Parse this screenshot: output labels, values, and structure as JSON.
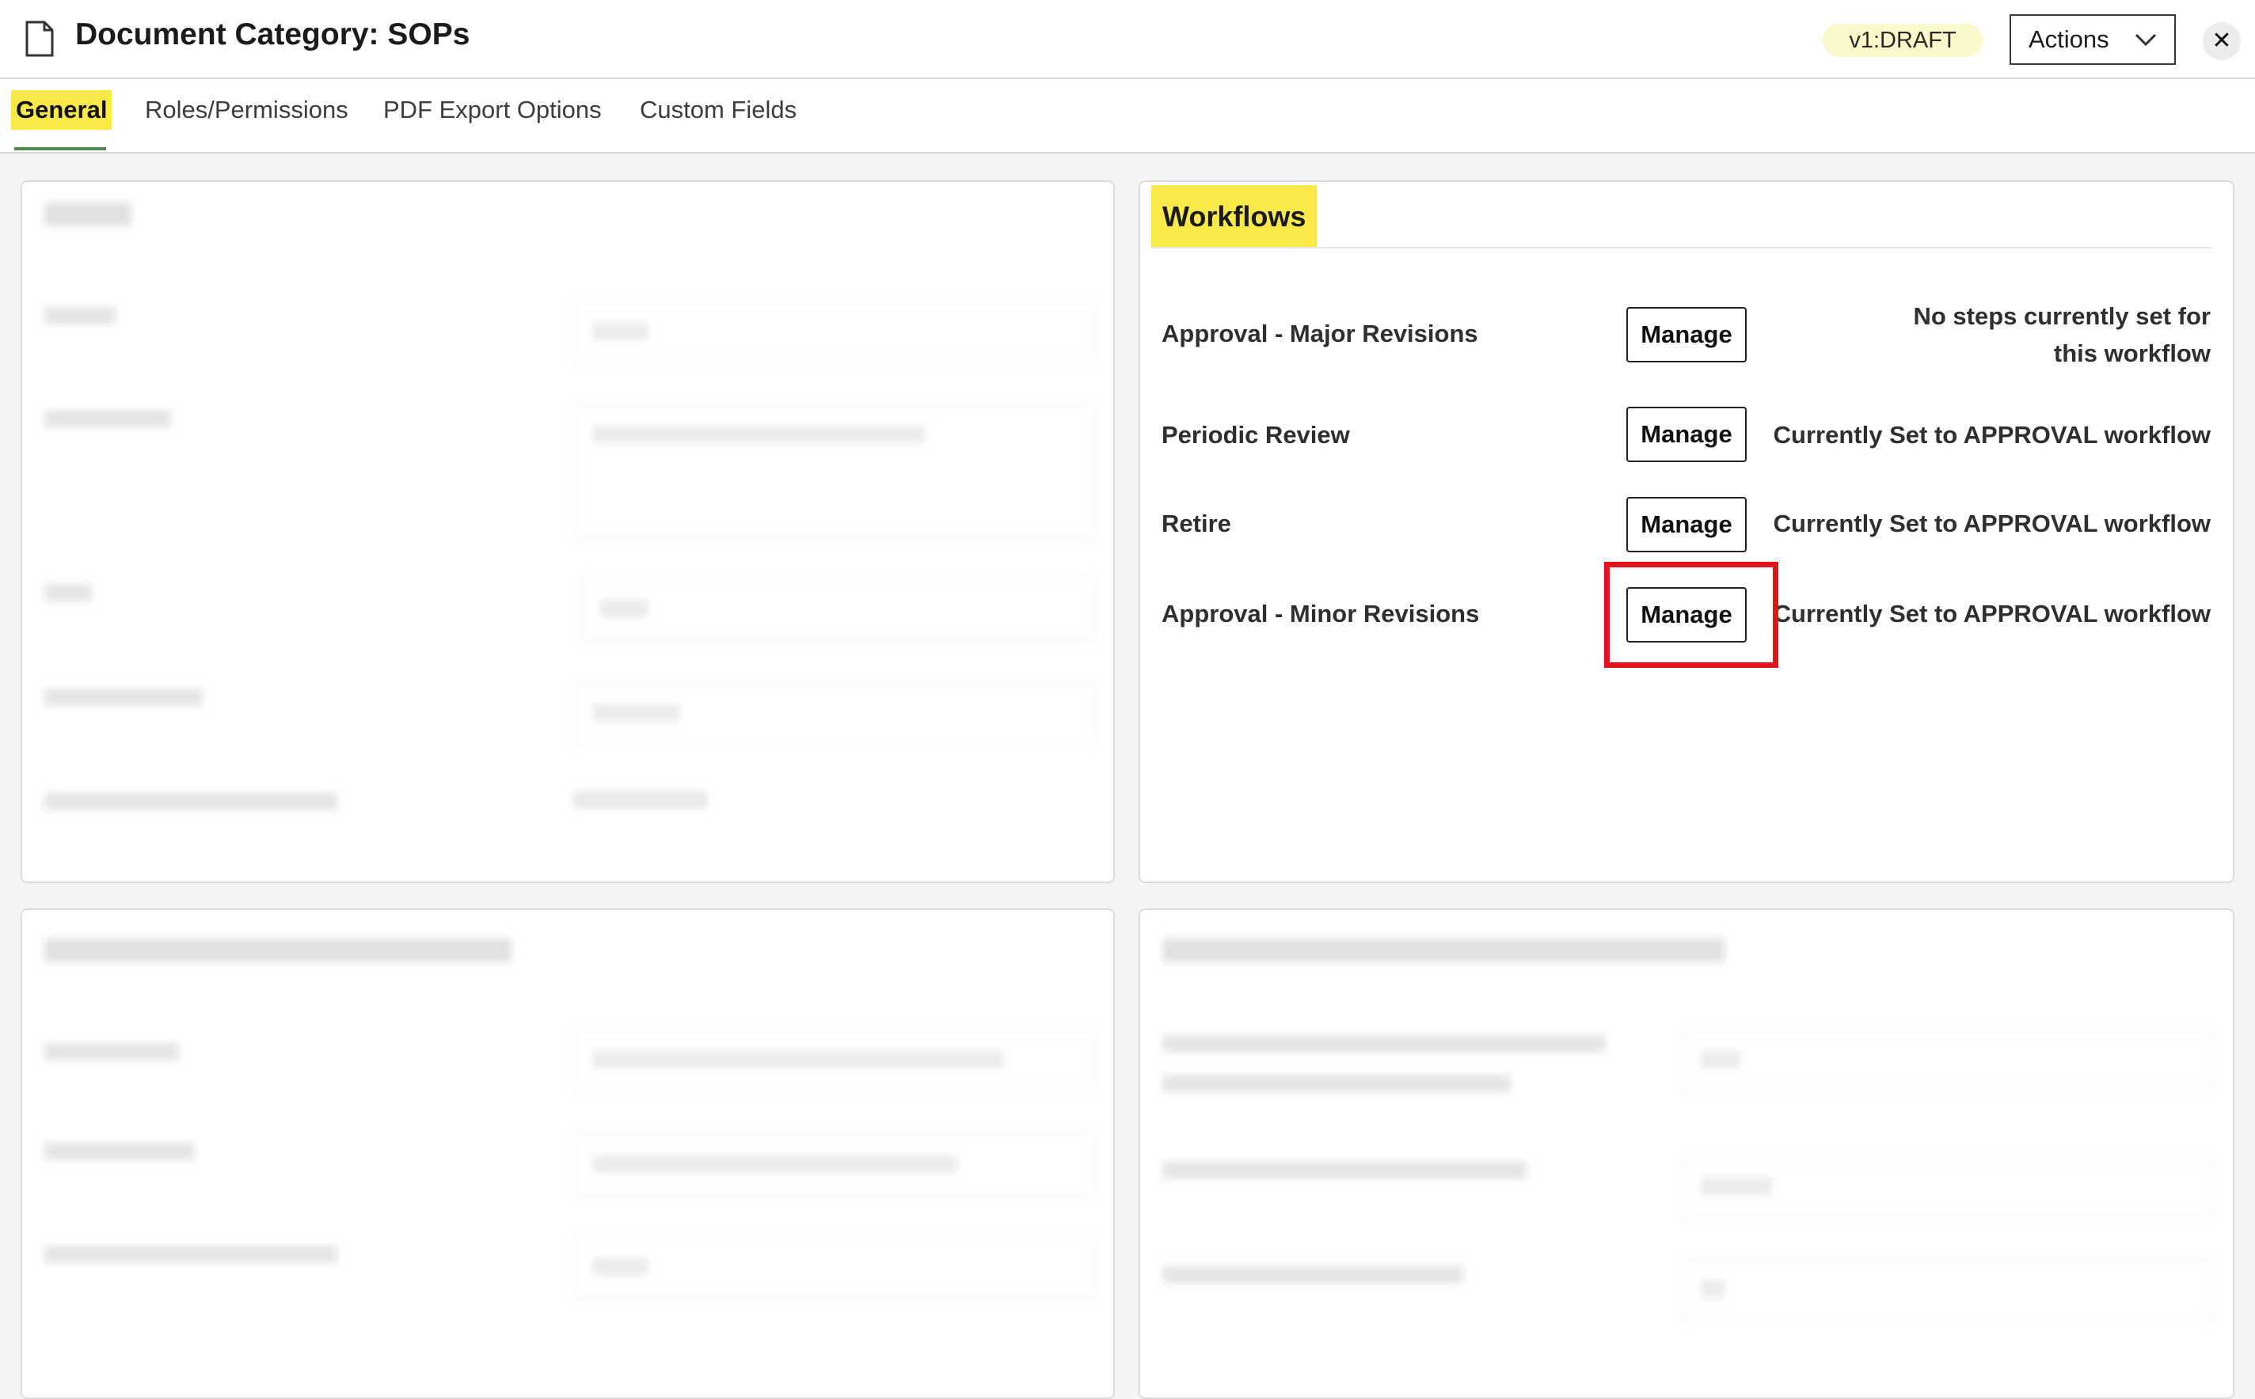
{
  "header": {
    "title": "Document Category: SOPs",
    "version_badge": "v1:DRAFT",
    "actions_label": "Actions",
    "close_label": "✕"
  },
  "tabs": [
    {
      "label": "General",
      "active": true
    },
    {
      "label": "Roles/Permissions",
      "active": false
    },
    {
      "label": "PDF Export Options",
      "active": false
    },
    {
      "label": "Custom Fields",
      "active": false
    }
  ],
  "workflows": {
    "heading": "Workflows",
    "items": [
      {
        "name": "Approval - Major Revisions",
        "button": "Manage",
        "status": "No steps currently set for this workflow"
      },
      {
        "name": "Periodic Review",
        "button": "Manage",
        "status": "Currently Set to APPROVAL workflow"
      },
      {
        "name": "Retire",
        "button": "Manage",
        "status": "Currently Set to APPROVAL workflow"
      },
      {
        "name": "Approval - Minor Revisions",
        "button": "Manage",
        "status": "Currently Set to APPROVAL workflow"
      }
    ]
  },
  "colors": {
    "highlight": "#fbe94a",
    "annotation_box": "#e0141c",
    "active_tab_underline": "#4f8a4f"
  },
  "icons": {
    "document": "document-icon",
    "chevron": "chevron-down-icon",
    "close": "close-icon"
  }
}
